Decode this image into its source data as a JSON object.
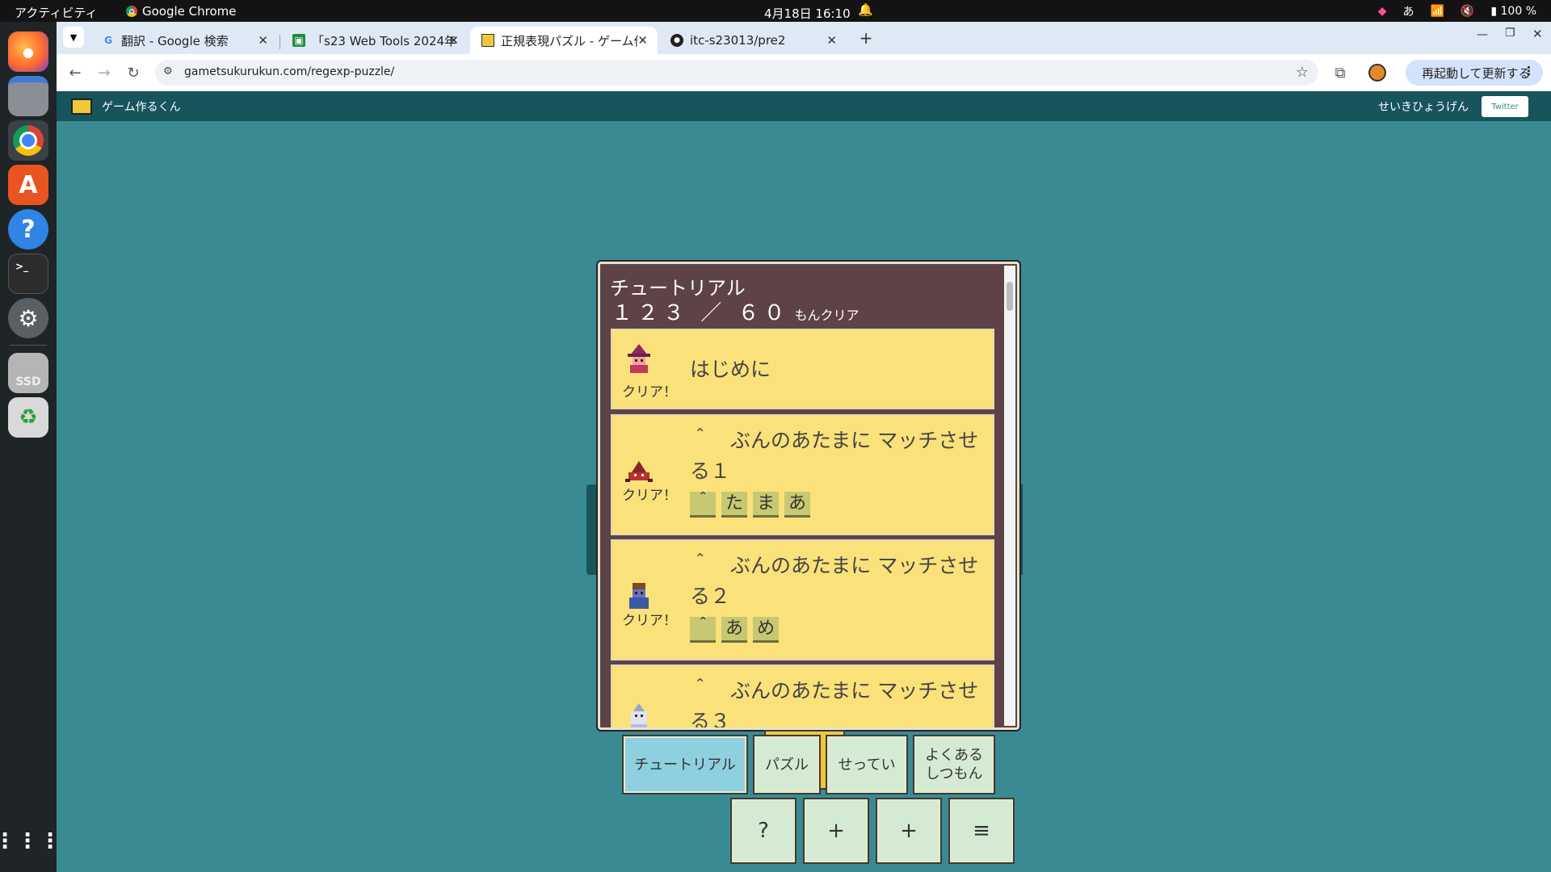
{
  "topbar": {
    "activities": "アクティビティ",
    "app_name": "Google Chrome",
    "clock": "4月18日  16:10",
    "ime": "あ",
    "battery": "100 %"
  },
  "dock": {
    "items": [
      "firefox-icon",
      "files-icon",
      "chrome-icon",
      "app-center-icon",
      "help-icon",
      "terminal-icon",
      "settings-icon",
      "ssd-drive-icon",
      "trash-icon",
      "app-grid-icon"
    ],
    "ssd_label": "SSD"
  },
  "tabs": [
    {
      "title": "翻訳 - Google 検索",
      "icon": "google-icon"
    },
    {
      "title": "「s23 Web Tools 2024年",
      "icon": "classroom-icon"
    },
    {
      "title": "正規表現パズル - ゲーム作",
      "icon": "game-icon"
    },
    {
      "title": "itc-s23013/pre2",
      "icon": "github-icon"
    }
  ],
  "toolbar": {
    "url": "gametsukurukun.com/regexp-puzzle/",
    "relaunch_label": "再起動して更新する"
  },
  "site": {
    "name": "ゲーム作るくん",
    "mode": "せいきひょうげん",
    "twitter": "Twitter"
  },
  "panel": {
    "title": "チュートリアル",
    "progress": "１２３ ／ ６０",
    "progress_suffix": "もんクリア",
    "lessons": [
      {
        "title": "はじめに",
        "status": "クリア！",
        "chips": []
      },
      {
        "title": "＾　ぶんのあたまに マッチさせる１",
        "status": "クリア！",
        "chips": [
          "＾",
          "た",
          "ま",
          "あ"
        ]
      },
      {
        "title": "＾　ぶんのあたまに マッチさせる２",
        "status": "クリア！",
        "chips": [
          "＾",
          "あ",
          "め"
        ]
      },
      {
        "title": "＾　ぶんのあたまに マッチさせる３",
        "status": "",
        "chips": []
      }
    ]
  },
  "nav_tabs": [
    "チュートリアル",
    "パズル",
    "せってい",
    "よくある しつもん"
  ],
  "controls": [
    "?",
    "+",
    "+",
    "≡"
  ]
}
